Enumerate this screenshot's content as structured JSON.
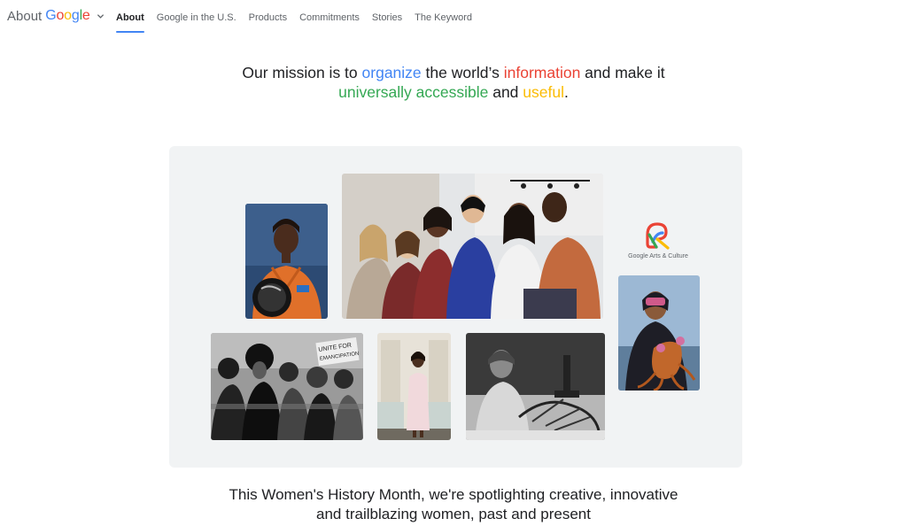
{
  "header": {
    "brand_prefix": "About",
    "brand_letters": [
      {
        "ch": "G",
        "color": "#4285f4"
      },
      {
        "ch": "o",
        "color": "#ea4335"
      },
      {
        "ch": "o",
        "color": "#fbbc04"
      },
      {
        "ch": "g",
        "color": "#4285f4"
      },
      {
        "ch": "l",
        "color": "#34a853"
      },
      {
        "ch": "e",
        "color": "#ea4335"
      }
    ],
    "nav": [
      {
        "label": "About",
        "active": true
      },
      {
        "label": "Google in the U.S.",
        "active": false
      },
      {
        "label": "Products",
        "active": false
      },
      {
        "label": "Commitments",
        "active": false
      },
      {
        "label": "Stories",
        "active": false
      },
      {
        "label": "The Keyword",
        "active": false
      }
    ]
  },
  "mission": {
    "t1": "Our mission is to ",
    "w_organize": "organize",
    "t2": " the world’s ",
    "w_information": "information",
    "t3": " and make it",
    "w_accessible": "universally accessible",
    "t4": " and ",
    "w_useful": "useful",
    "t5": "."
  },
  "gallery": {
    "arts_culture_label": "Google Arts & Culture",
    "sign_line1": "UNITE FOR",
    "sign_line2": "EMANCIPATION"
  },
  "tagline": {
    "line1": "This Women's History Month, we're spotlighting creative, innovative",
    "line2": "and trailblazing women, past and present"
  },
  "colors": {
    "blue": "#4285f4",
    "red": "#ea4335",
    "yellow": "#fbbc04",
    "green": "#34a853",
    "panel_bg": "#f1f3f4"
  }
}
